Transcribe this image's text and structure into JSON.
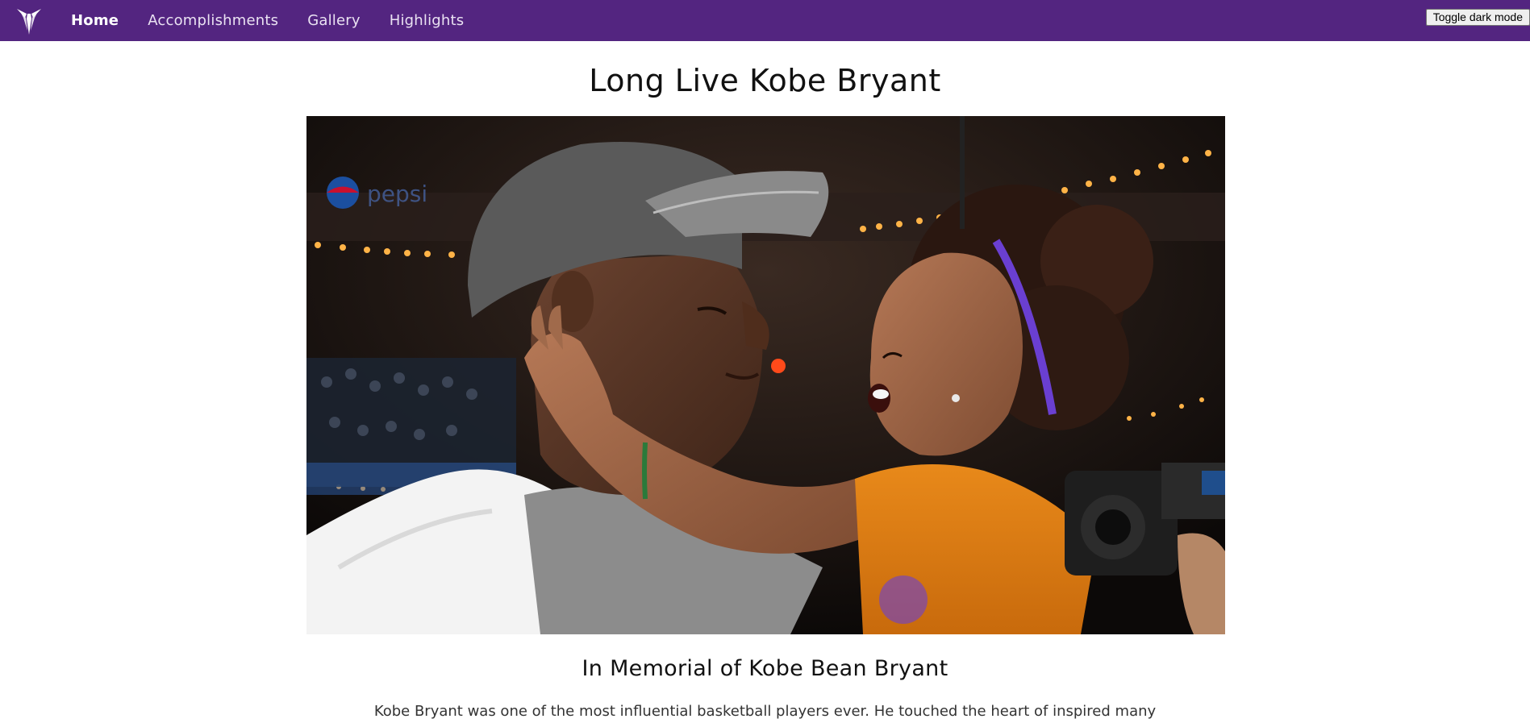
{
  "nav": {
    "logo_icon": "kobe-sheath-logo-icon",
    "items": [
      {
        "label": "Home",
        "active": true
      },
      {
        "label": "Accomplishments",
        "active": false
      },
      {
        "label": "Gallery",
        "active": false
      },
      {
        "label": "Highlights",
        "active": false
      }
    ],
    "toggle_label": "Toggle dark mode"
  },
  "main": {
    "title": "Long Live Kobe Bryant",
    "hero_image": "photo-kobe-and-daughter",
    "subtitle": "In Memorial of Kobe Bean Bryant",
    "intro": "Kobe Bryant was one of the most influential basketball players ever. He touched the heart of inspired many"
  },
  "colors": {
    "navbar_bg": "#532580",
    "nav_text": "#ffffff",
    "page_bg": "#ffffff"
  }
}
